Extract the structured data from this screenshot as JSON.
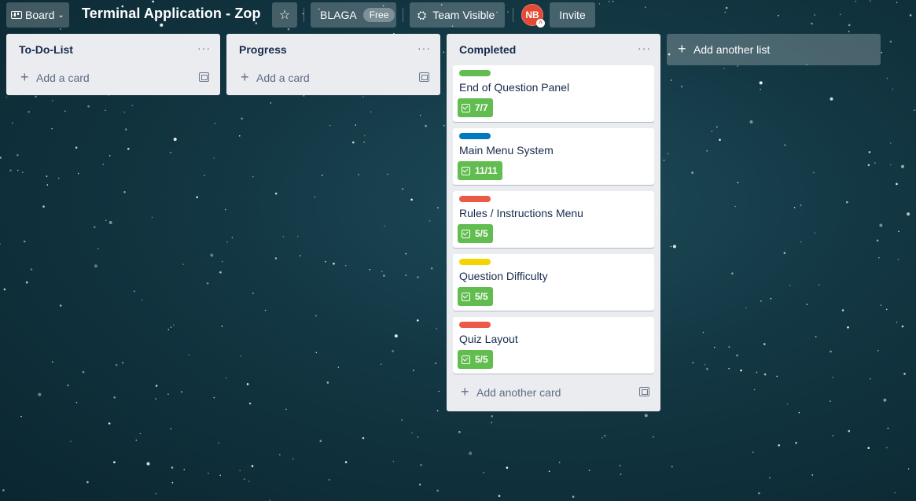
{
  "header": {
    "board_button": "Board",
    "board_title": "Terminal Application - Zop",
    "workspace": "BLAGA",
    "workspace_badge": "Free",
    "visibility": "Team Visible",
    "member_initials": "NB",
    "invite": "Invite"
  },
  "lists": [
    {
      "title": "To-Do-List",
      "add_card": "Add a card",
      "cards": []
    },
    {
      "title": "Progress",
      "add_card": "Add a card",
      "cards": []
    },
    {
      "title": "Completed",
      "add_card": "Add another card",
      "cards": [
        {
          "label_color": "#61bd4f",
          "title": "End of Question Panel",
          "checklist": "7/7"
        },
        {
          "label_color": "#0079bf",
          "title": "Main Menu System",
          "checklist": "11/11"
        },
        {
          "label_color": "#eb5a46",
          "title": "Rules / Instructions Menu",
          "checklist": "5/5"
        },
        {
          "label_color": "#f2d600",
          "title": "Question Difficulty",
          "checklist": "5/5"
        },
        {
          "label_color": "#eb5a46",
          "title": "Quiz Layout",
          "checklist": "5/5"
        }
      ]
    }
  ],
  "add_list": "Add another list",
  "icons": {
    "board": "board-icon",
    "chevron": "chevron-down-icon",
    "star": "star-icon",
    "team": "team-icon",
    "menu": "more-icon",
    "plus": "plus-icon",
    "template": "template-icon",
    "checklist": "checklist-icon"
  },
  "colors": {
    "list_bg": "#ebecf0",
    "badge_complete": "#61bd4f",
    "avatar": "#e34935"
  }
}
